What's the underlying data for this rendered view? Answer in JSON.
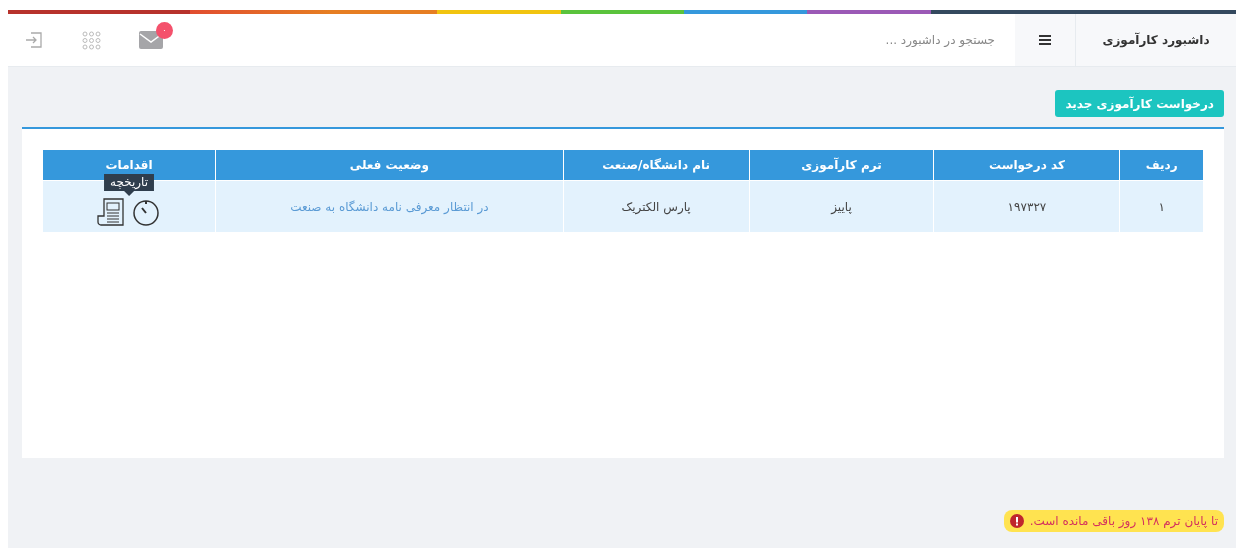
{
  "header": {
    "title": "داشبورد کارآموزی",
    "search": {
      "placeholder": "جستجو در داشبورد ..."
    },
    "mail_badge": "۰"
  },
  "new_request_button": "درخواست کارآموزی جدید",
  "table": {
    "columns": [
      "ردیف",
      "کد درخواست",
      "ترم کارآموزی",
      "نام دانشگاه/صنعت",
      "وضعیت فعلی",
      "اقدامات"
    ],
    "rows": [
      {
        "cells": [
          "۱",
          "۱۹۷۳۲۷",
          "پاییز",
          "پارس الکتریک",
          "در انتظار معرفی نامه دانشگاه به صنعت"
        ],
        "tooltip": "تاریخچه"
      }
    ]
  },
  "alert": "تا پایان ترم ۱۳۸ روز باقی مانده است."
}
